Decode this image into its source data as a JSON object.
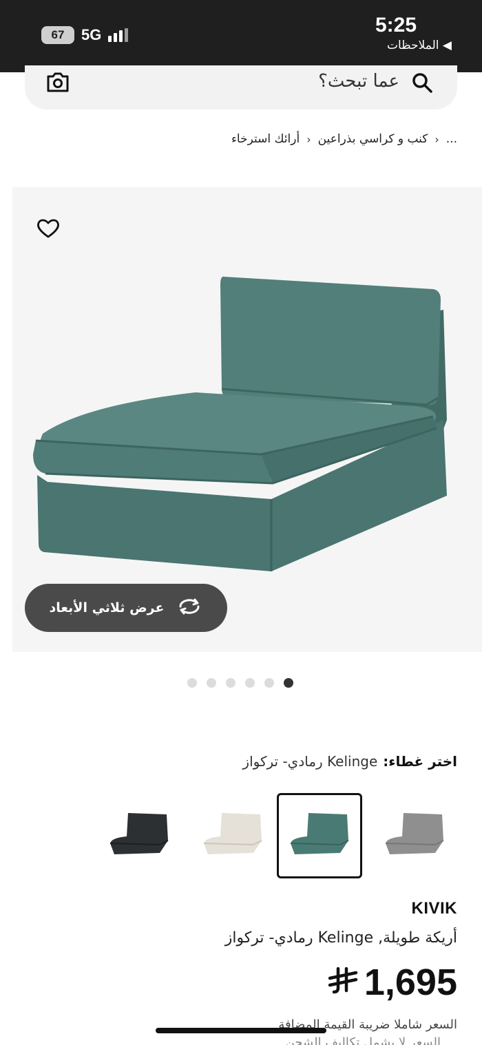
{
  "status_bar": {
    "time": "5:25",
    "back_label": "◀ الملاحظات",
    "battery": "67",
    "network": "5G"
  },
  "search": {
    "placeholder": "عما تبحث؟"
  },
  "breadcrumb": {
    "ellipsis": "...",
    "items": [
      "كنب و كراسي بذراعين",
      "أرائك استرخاء"
    ]
  },
  "gallery": {
    "view_3d_label": "عرض ثلاثي الأبعاد",
    "dots_total": 6,
    "active_dot": 6
  },
  "cover": {
    "label": "اختر غطاء:",
    "value": "Kelinge رمادي- تركواز"
  },
  "swatches": [
    {
      "color": "#8f8f8f",
      "selected": false
    },
    {
      "color": "#4a7a74",
      "selected": true
    },
    {
      "color": "#e6e1d8",
      "selected": false
    },
    {
      "color": "#2d3033",
      "selected": false
    }
  ],
  "product": {
    "brand": "KIVIK",
    "description": "أريكة طويلة, Kelinge رمادي- تركواز",
    "price": "1,695",
    "currency_symbol": "⃁",
    "tax_note": "السعر شاملا ضريبة القيمة المضافة",
    "tax_note_2": "السعر لا يشمل تكاليف الشحن"
  },
  "colors": {
    "status_bar_bg": "#1f1f1f",
    "sofa": "#4e7b76",
    "button_dark": "#4a4a4a"
  }
}
